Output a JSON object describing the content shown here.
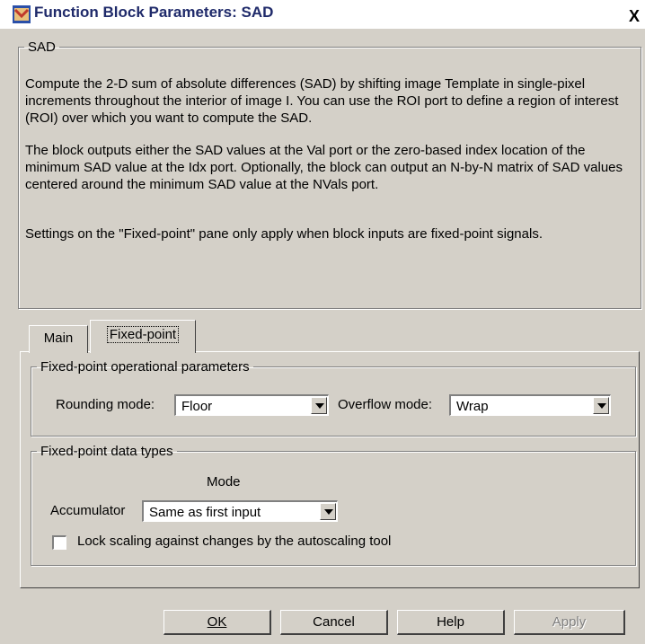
{
  "window": {
    "title": "Function Block Parameters: SAD",
    "close_label": "X"
  },
  "description": {
    "group_label": "SAD",
    "paragraphs": [
      "Compute the 2-D sum of absolute differences (SAD) by shifting image Template  in single-pixel increments throughout the interior of image I. You can use the ROI port to define a region of interest (ROI) over which you want to compute the SAD.",
      "The block outputs either the SAD values at the Val port or the zero-based index location of the minimum SAD value at the Idx port.  Optionally, the block can output an N-by-N matrix of SAD values centered around the minimum SAD value at the NVals port.",
      "Settings on the \"Fixed-point\" pane only apply when block inputs are fixed-point signals."
    ]
  },
  "tabs": [
    {
      "label": "Main"
    },
    {
      "label": "Fixed-point",
      "selected": true
    }
  ],
  "operational": {
    "group_label": "Fixed-point operational parameters",
    "rounding_label": "Rounding mode:",
    "rounding_value": "Floor",
    "overflow_label": "Overflow mode:",
    "overflow_value": "Wrap"
  },
  "data_types": {
    "group_label": "Fixed-point data types",
    "mode_header": "Mode",
    "accumulator_label": "Accumulator",
    "accumulator_value": "Same as first input",
    "lock_label": "Lock scaling against changes by the autoscaling tool",
    "lock_checked": false
  },
  "buttons": {
    "ok": "OK",
    "cancel": "Cancel",
    "help": "Help",
    "apply": "Apply"
  }
}
